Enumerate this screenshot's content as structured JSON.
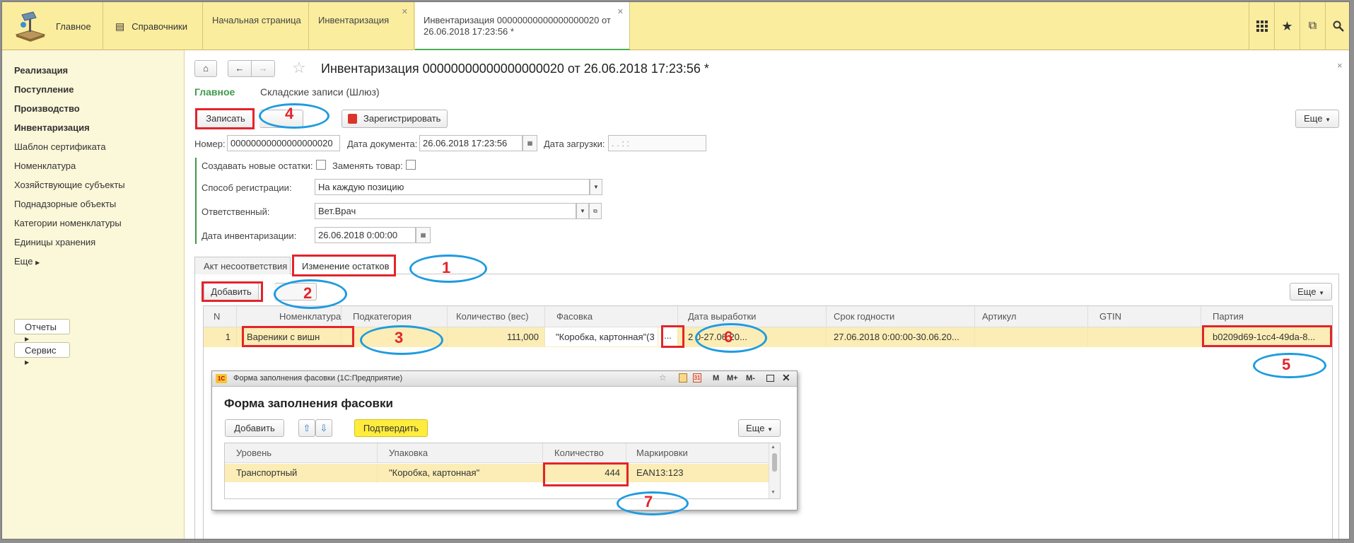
{
  "topbar": {
    "home": "Главное",
    "refs": "Справочники",
    "tabs": [
      "Начальная страница",
      "Инвентаризация",
      "Инвентаризация 00000000000000000020 от 26.06.2018 17:23:56 *"
    ],
    "tab_active_line1": "Инвентаризация 00000000000000000020 от",
    "tab_active_line2": "26.06.2018 17:23:56 *"
  },
  "sidebar": {
    "items": [
      "Реализация",
      "Поступление",
      "Производство",
      "Инвентаризация",
      "Шаблон сертификата",
      "Номенклатура",
      "Хозяйствующие субъекты",
      "Поднадзорные объекты",
      "Категории номенклатуры",
      "Единицы хранения"
    ],
    "more": "Еще",
    "reports": "Отчеты",
    "service": "Сервис"
  },
  "doc": {
    "title": "Инвентаризация 00000000000000000020 от 26.06.2018 17:23:56 *",
    "nav_main": "Главное",
    "nav_records": "Складские записи (Шлюз)",
    "save": "Записать",
    "register": "Зарегистрировать",
    "more": "Еще",
    "close": "×"
  },
  "fields": {
    "number_label": "Номер:",
    "number": "00000000000000000020",
    "doc_date_label": "Дата документа:",
    "doc_date": "26.06.2018 17:23:56",
    "load_date_label": "Дата загрузки:",
    "load_date": ".  .       :  :",
    "create_label": "Создавать новые остатки:",
    "replace_label": "Заменять товар:",
    "reg_label": "Способ регистрации:",
    "reg_value": "На каждую позицию",
    "resp_label": "Ответственный:",
    "resp_value": "Вет.Врач",
    "inv_date_label": "Дата инвентаризации:",
    "inv_date": "26.06.2018  0:00:00"
  },
  "tabs": {
    "t1": "Акт несоответствия",
    "t2": "Изменение остатков"
  },
  "table": {
    "add": "Добавить",
    "more": "Еще",
    "headers": [
      "N",
      "Номенклатура",
      "Подкатегория",
      "Количество (вес)",
      "Фасовка",
      "Дата выработки",
      "Срок годности",
      "Артикул",
      "GTIN",
      "Партия"
    ],
    "row": {
      "n": "1",
      "name": "Вареники с вишн",
      "sub": "",
      "qty": "111,000",
      "pack": "\"Коробка, картонная\"(3",
      "dots": "...",
      "prod": "2                 0-27.06.20...",
      "expiry": "27.06.2018 0:00:00-30.06.20...",
      "article": "",
      "gtin": "",
      "batch": "b0209d69-1cc4-49da-8..."
    }
  },
  "dialog": {
    "title": "Форма заполнения фасовки  (1С:Предприятие)",
    "heading": "Форма заполнения фасовки",
    "add": "Добавить",
    "confirm": "Подтвердить",
    "more": "Еще",
    "headers": [
      "Уровень",
      "Упаковка",
      "Количество",
      "Маркировки"
    ],
    "row": {
      "level": "Транспортный",
      "pack": "\"Коробка, картонная\"",
      "qty": "444",
      "mark": "EAN13:123"
    },
    "ctrl": [
      "M",
      "M+",
      "M-"
    ]
  },
  "annotations": [
    "1",
    "2",
    "3",
    "4",
    "5",
    "6",
    "7"
  ],
  "colors": {
    "topbar": "#fbed9e",
    "sidebar": "#fbf7d9",
    "selected_row": "#fbedb5",
    "annot_red": "#e3242b",
    "annot_blue": "#1e9be0",
    "confirm": "#ffec3d",
    "green_nav": "#3f9a4b"
  },
  "icons": [
    "logo-icon",
    "references-icon",
    "grid-icon",
    "star-icon",
    "history-icon",
    "search-icon",
    "home-icon",
    "back-arrow-icon",
    "forward-arrow-icon",
    "favorite-star-icon",
    "register-icon",
    "calendar-icon",
    "dropdown-icon",
    "open-icon",
    "up-arrow-icon",
    "down-arrow-icon",
    "1c-logo-icon"
  ]
}
